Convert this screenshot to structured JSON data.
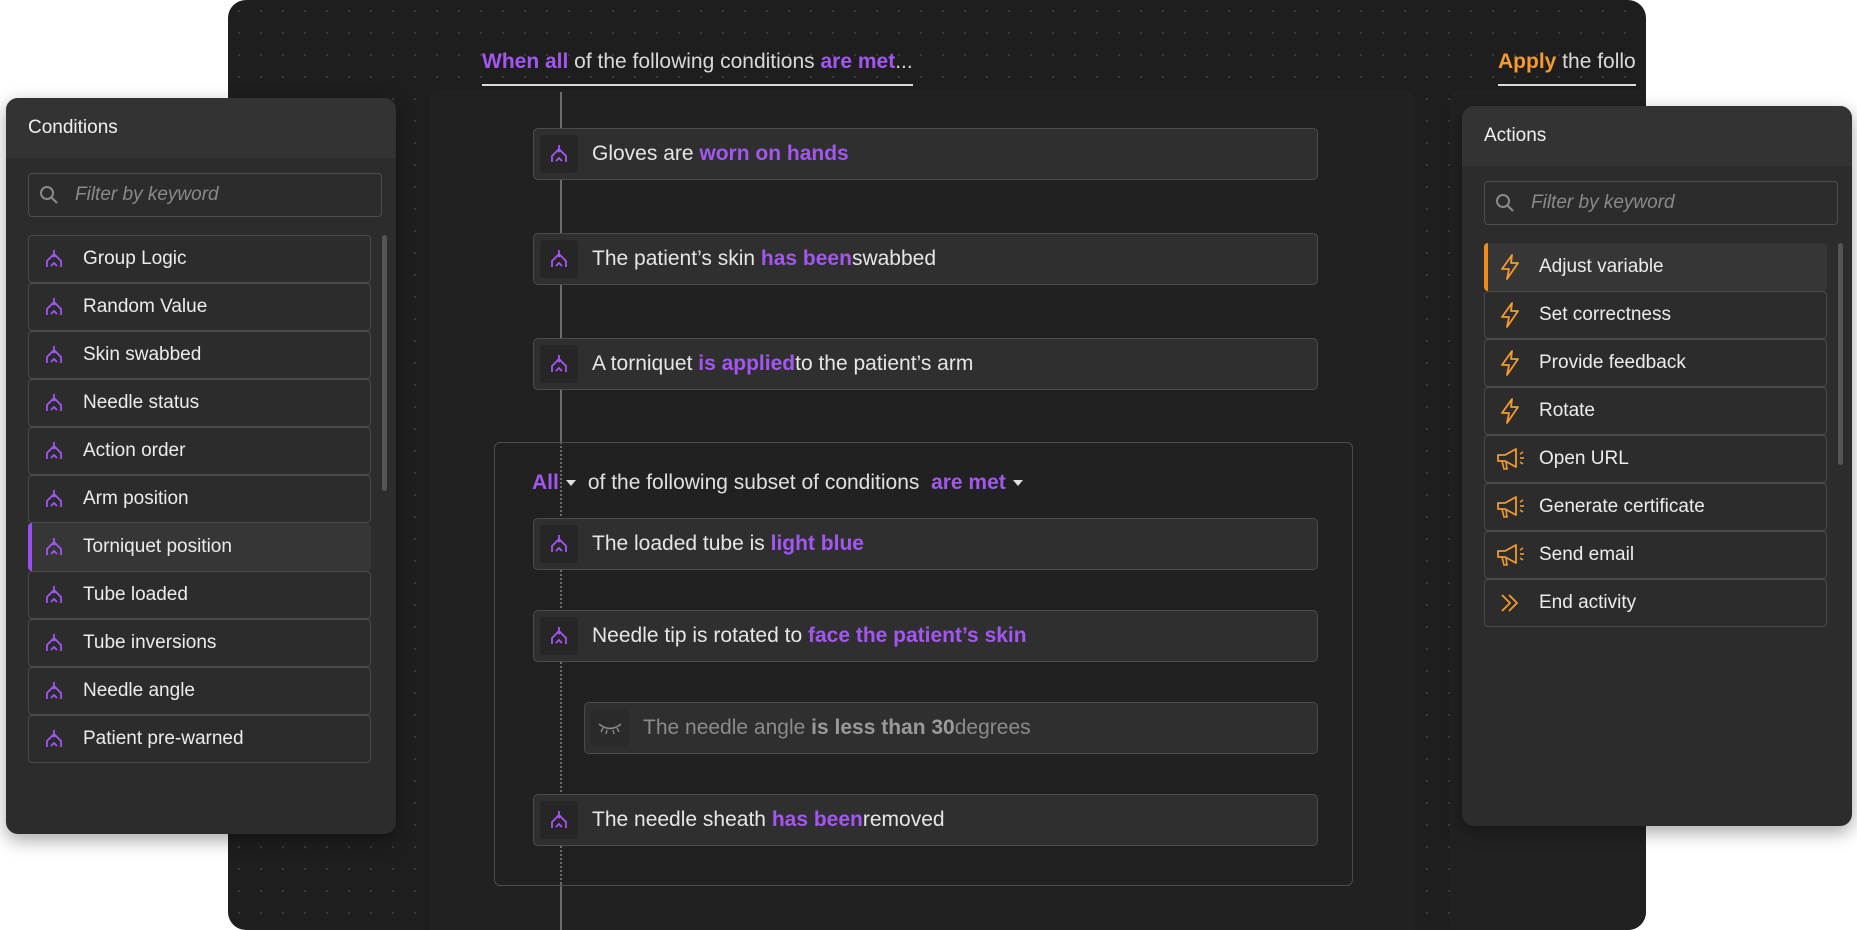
{
  "workspace": {
    "when_heading": {
      "a": "When all",
      "b": " of the following conditions ",
      "c": "are met",
      "d": "..."
    },
    "apply_heading": {
      "a": "Apply",
      "b": " the follo"
    },
    "conditions": [
      {
        "pre": "Gloves are ",
        "hl": "worn on hands",
        "post": ""
      },
      {
        "pre": "The patient’s skin ",
        "hl": "has been",
        "post": " swabbed"
      },
      {
        "pre": "A torniquet ",
        "hl": "is applied",
        "post": " to the patient’s arm"
      }
    ],
    "subset": {
      "quantifier": "All",
      "middle": "of the following subset of conditions",
      "verb": "are met",
      "conditions": [
        {
          "pre": "The loaded tube is ",
          "hl": "light blue",
          "post": ""
        },
        {
          "pre": "Needle tip is rotated to ",
          "hl": "face the patient’s skin",
          "post": ""
        },
        {
          "pre": "The needle angle ",
          "hl": "is less than 30",
          "post": " degrees",
          "disabled": true
        },
        {
          "pre": "The needle sheath ",
          "hl": "has been",
          "post": " removed"
        }
      ]
    }
  },
  "conditions_panel": {
    "title": "Conditions",
    "search_placeholder": "Filter by keyword",
    "items": [
      "Group Logic",
      "Random Value",
      "Skin swabbed",
      "Needle status",
      "Action order",
      "Arm position",
      "Torniquet position",
      "Tube loaded",
      "Tube inversions",
      "Needle angle",
      "Patient pre-warned"
    ],
    "selected": "Torniquet position"
  },
  "actions_panel": {
    "title": "Actions",
    "search_placeholder": "Filter by keyword",
    "items": [
      {
        "label": "Adjust variable",
        "icon": "lightning-icon"
      },
      {
        "label": "Set correctness",
        "icon": "lightning-icon"
      },
      {
        "label": "Provide feedback",
        "icon": "lightning-icon"
      },
      {
        "label": "Rotate",
        "icon": "lightning-icon"
      },
      {
        "label": "Open URL",
        "icon": "megaphone-icon"
      },
      {
        "label": "Generate certificate",
        "icon": "megaphone-icon"
      },
      {
        "label": "Send email",
        "icon": "megaphone-icon"
      },
      {
        "label": "End activity",
        "icon": "double-chevron-right-icon"
      }
    ],
    "selected": "Adjust variable"
  },
  "colors": {
    "purple": "#a356f0",
    "orange": "#f59a2c",
    "canvas": "#1e1e1e"
  }
}
